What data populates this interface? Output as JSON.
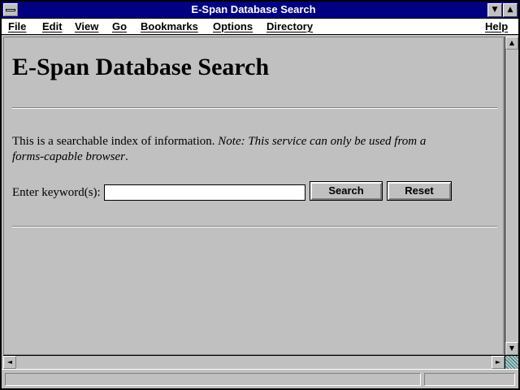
{
  "window": {
    "title": "E-Span Database Search",
    "minimize_glyph": "▼",
    "maximize_glyph": "▲"
  },
  "menubar": {
    "items": [
      "File",
      "Edit",
      "View",
      "Go",
      "Bookmarks",
      "Options",
      "Directory",
      "Help"
    ]
  },
  "page": {
    "heading": "E-Span Database Search",
    "intro_text": "This is a searchable index of information. ",
    "note_text": "Note: This service can only be used from a forms-capable browser",
    "note_end": ".",
    "keyword_label": "Enter keyword(s):",
    "keyword_value": "",
    "search_button": "Search",
    "reset_button": "Reset"
  },
  "scrollbar": {
    "up_glyph": "▲",
    "down_glyph": "▼",
    "left_glyph": "◄",
    "right_glyph": "►"
  },
  "status": {
    "text": ""
  },
  "colors": {
    "titlebar": "#000080",
    "window_bg": "#c0c0c0"
  }
}
